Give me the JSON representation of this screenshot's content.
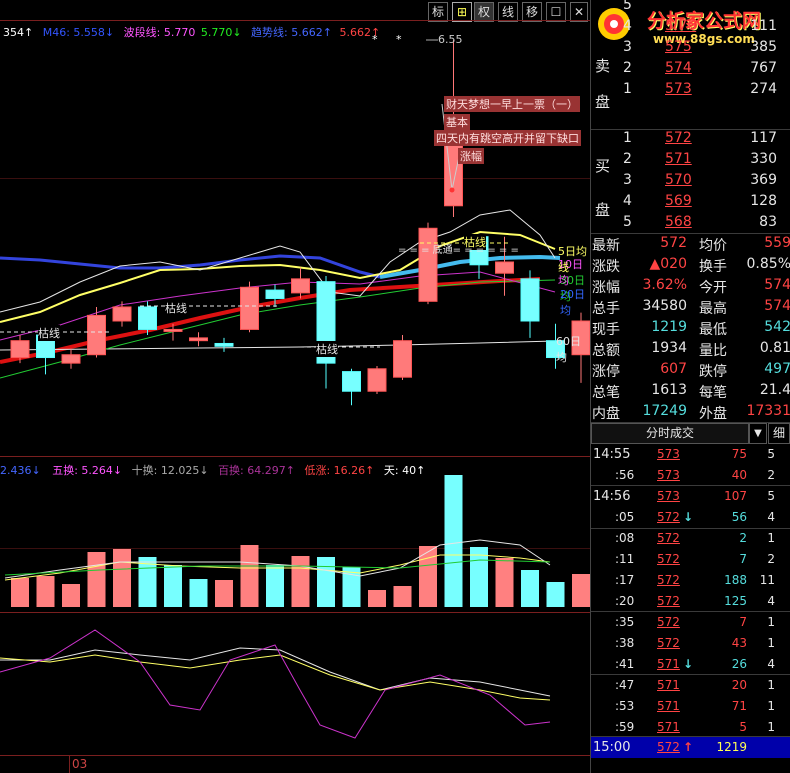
{
  "toolbar": {
    "buttons": [
      "标",
      "⊞",
      "权",
      "线",
      "移",
      "☐",
      "✕"
    ]
  },
  "ma_header": [
    {
      "text": "354↑",
      "color": "#ffffff"
    },
    {
      "text": "M46: 5.558↓",
      "color": "#3355ff"
    },
    {
      "text": "波段线: 5.770",
      "color": "#ff55ff"
    },
    {
      "text": "5.770↓",
      "color": "#22ee22"
    },
    {
      "text": "趋势线: 5.662↑",
      "color": "#4466ff"
    },
    {
      "text": "5.662↑",
      "color": "#ff4444"
    }
  ],
  "volume_header": [
    {
      "text": "2.436↓",
      "color": "#4466ff"
    },
    {
      "text": "五换: 5.264↓",
      "color": "#ff55ff"
    },
    {
      "text": "十换: 12.025↓",
      "color": "#aaaaaa"
    },
    {
      "text": "百换: 64.297↑",
      "color": "#aa3399"
    },
    {
      "text": "低涨: 16.26↑",
      "color": "#ff4444"
    },
    {
      "text": "天: 40↑",
      "color": "#ffffff"
    }
  ],
  "chart_labels": {
    "high_price": "6.55",
    "ann_1": "财天梦想一早上一票（一）",
    "ann_2": "基本",
    "ann_3": "四天内有跳空高开并留下缺口",
    "ann_4": "涨幅",
    "ku_1": "枯线",
    "ku_2": "枯线",
    "ku_3": "枯线",
    "ku_4": "枯线",
    "tongdao": "= = = 底通= = = = = =",
    "ma60": "60日均",
    "ma30": "30日均",
    "ma20": "20日均",
    "ma10": "10日均",
    "ma5": "5日均线",
    "date": "03"
  },
  "candles": [
    {
      "o": 5.42,
      "c": 5.48,
      "h": 5.5,
      "l": 5.4
    },
    {
      "o": 5.5,
      "c": 5.42,
      "h": 5.52,
      "l": 5.36
    },
    {
      "o": 5.4,
      "c": 5.43,
      "h": 5.45,
      "l": 5.38
    },
    {
      "o": 5.43,
      "c": 5.57,
      "h": 5.6,
      "l": 5.42
    },
    {
      "o": 5.55,
      "c": 5.6,
      "h": 5.62,
      "l": 5.53
    },
    {
      "o": 5.6,
      "c": 5.52,
      "h": 5.62,
      "l": 5.5
    },
    {
      "o": 5.52,
      "c": 5.52,
      "h": 5.54,
      "l": 5.48
    },
    {
      "o": 5.48,
      "c": 5.49,
      "h": 5.51,
      "l": 5.46
    },
    {
      "o": 5.47,
      "c": 5.46,
      "h": 5.49,
      "l": 5.44
    },
    {
      "o": 5.52,
      "c": 5.67,
      "h": 5.69,
      "l": 5.51
    },
    {
      "o": 5.66,
      "c": 5.63,
      "h": 5.68,
      "l": 5.6
    },
    {
      "o": 5.65,
      "c": 5.7,
      "h": 5.74,
      "l": 5.63
    },
    {
      "o": 5.69,
      "c": 5.4,
      "h": 5.71,
      "l": 5.31
    },
    {
      "o": 5.37,
      "c": 5.3,
      "h": 5.38,
      "l": 5.25
    },
    {
      "o": 5.3,
      "c": 5.38,
      "h": 5.39,
      "l": 5.29
    },
    {
      "o": 5.35,
      "c": 5.48,
      "h": 5.5,
      "l": 5.34
    },
    {
      "o": 5.62,
      "c": 5.88,
      "h": 5.9,
      "l": 5.61
    },
    {
      "o": 5.96,
      "c": 6.26,
      "h": 6.55,
      "l": 5.92
    },
    {
      "o": 5.85,
      "c": 5.75,
      "h": 5.86,
      "l": 5.7
    },
    {
      "o": 5.72,
      "c": 5.76,
      "h": 5.85,
      "l": 5.64
    },
    {
      "o": 5.7,
      "c": 5.55,
      "h": 5.73,
      "l": 5.49
    },
    {
      "o": 5.48,
      "c": 5.42,
      "h": 5.54,
      "l": 5.38
    },
    {
      "o": 5.43,
      "c": 5.55,
      "h": 5.58,
      "l": 5.33
    }
  ],
  "volumes": [
    {
      "v": 29,
      "up": true
    },
    {
      "v": 31,
      "up": true
    },
    {
      "v": 23,
      "up": true
    },
    {
      "v": 55,
      "up": true
    },
    {
      "v": 58,
      "up": true
    },
    {
      "v": 50,
      "up": false
    },
    {
      "v": 42,
      "up": false
    },
    {
      "v": 28,
      "up": false
    },
    {
      "v": 27,
      "up": true
    },
    {
      "v": 62,
      "up": true
    },
    {
      "v": 42,
      "up": false
    },
    {
      "v": 51,
      "up": true
    },
    {
      "v": 50,
      "up": false
    },
    {
      "v": 40,
      "up": false
    },
    {
      "v": 17,
      "up": true
    },
    {
      "v": 21,
      "up": true
    },
    {
      "v": 61,
      "up": true
    },
    {
      "v": 132,
      "up": false
    },
    {
      "v": 60,
      "up": false
    },
    {
      "v": 49,
      "up": true
    },
    {
      "v": 37,
      "up": false
    },
    {
      "v": 25,
      "up": false
    },
    {
      "v": 33,
      "up": true
    }
  ],
  "logo": {
    "title": "分析家公式网",
    "url": "www.88gs.com"
  },
  "sell_label": [
    "卖",
    "盘"
  ],
  "buy_label": [
    "买",
    "盘"
  ],
  "sell_orders": [
    {
      "level": "5",
      "price": "",
      "vol": ""
    },
    {
      "level": "4",
      "price": "5.76",
      "vol": "111"
    },
    {
      "level": "3",
      "price": "575",
      "vol": "385"
    },
    {
      "level": "2",
      "price": "574",
      "vol": "767"
    },
    {
      "level": "1",
      "price": "573",
      "vol": "274"
    }
  ],
  "buy_orders": [
    {
      "level": "1",
      "price": "572",
      "vol": "117"
    },
    {
      "level": "2",
      "price": "571",
      "vol": "330"
    },
    {
      "level": "3",
      "price": "570",
      "vol": "369"
    },
    {
      "level": "4",
      "price": "569",
      "vol": "128"
    },
    {
      "level": "5",
      "price": "568",
      "vol": "83"
    }
  ],
  "stats": [
    {
      "l1": "最新",
      "v1": "572",
      "c1": "#ff4444",
      "l2": "均价",
      "v2": "559",
      "c2": "#ff4444"
    },
    {
      "l1": "涨跌",
      "v1": "▲020",
      "c1": "#ff4444",
      "l2": "换手",
      "v2": "0.85%",
      "c2": "#e6e6e6"
    },
    {
      "l1": "涨幅",
      "v1": "3.62%",
      "c1": "#ff4444",
      "l2": "今开",
      "v2": "574",
      "c2": "#ff4444"
    },
    {
      "l1": "总手",
      "v1": "34580",
      "c1": "#e6e6e6",
      "l2": "最高",
      "v2": "574",
      "c2": "#ff4444"
    },
    {
      "l1": "现手",
      "v1": "1219",
      "c1": "#55dddd",
      "l2": "最低",
      "v2": "542",
      "c2": "#55dddd"
    },
    {
      "l1": "总额",
      "v1": "1934",
      "c1": "#e6e6e6",
      "l2": "量比",
      "v2": "0.81",
      "c2": "#e6e6e6"
    },
    {
      "l1": "涨停",
      "v1": "607",
      "c1": "#ff4444",
      "l2": "跌停",
      "v2": "497",
      "c2": "#55dddd"
    },
    {
      "l1": "总笔",
      "v1": "1613",
      "c1": "#e6e6e6",
      "l2": "每笔",
      "v2": "21.4",
      "c2": "#e6e6e6"
    },
    {
      "l1": "内盘",
      "v1": "17249",
      "c1": "#55dddd",
      "l2": "外盘",
      "v2": "17331",
      "c2": "#ff4444"
    }
  ],
  "trades_tab": {
    "label": "分时成交",
    "arrow": "▼",
    "detail": "细"
  },
  "trades": [
    {
      "time": "14:55",
      "price": "573",
      "arrow": "",
      "vol": "75",
      "vc": "#ff4444",
      "n": "5",
      "big": true
    },
    {
      "time": ":56",
      "price": "573",
      "arrow": "",
      "vol": "40",
      "vc": "#ff4444",
      "n": "2",
      "big": false
    },
    {
      "time": "14:56",
      "price": "573",
      "arrow": "",
      "vol": "107",
      "vc": "#ff4444",
      "n": "5",
      "big": true
    },
    {
      "time": ":05",
      "price": "572",
      "arrow": "↓",
      "vol": "56",
      "vc": "#55dddd",
      "n": "4",
      "big": false
    },
    {
      "time": ":08",
      "price": "572",
      "arrow": "",
      "vol": "2",
      "vc": "#55dddd",
      "n": "1",
      "big": false
    },
    {
      "time": ":11",
      "price": "572",
      "arrow": "",
      "vol": "7",
      "vc": "#55dddd",
      "n": "2",
      "big": false
    },
    {
      "time": ":17",
      "price": "572",
      "arrow": "",
      "vol": "188",
      "vc": "#55dddd",
      "n": "11",
      "big": false
    },
    {
      "time": ":20",
      "price": "572",
      "arrow": "",
      "vol": "125",
      "vc": "#55dddd",
      "n": "4",
      "big": false
    },
    {
      "time": ":35",
      "price": "572",
      "arrow": "",
      "vol": "7",
      "vc": "#ff4444",
      "n": "1",
      "big": false
    },
    {
      "time": ":38",
      "price": "572",
      "arrow": "",
      "vol": "43",
      "vc": "#ff4444",
      "n": "1",
      "big": false
    },
    {
      "time": ":41",
      "price": "571",
      "arrow": "↓",
      "vol": "26",
      "vc": "#55dddd",
      "n": "4",
      "big": false
    },
    {
      "time": ":47",
      "price": "571",
      "arrow": "",
      "vol": "20",
      "vc": "#ff4444",
      "n": "1",
      "big": false
    },
    {
      "time": ":53",
      "price": "571",
      "arrow": "",
      "vol": "71",
      "vc": "#ff4444",
      "n": "1",
      "big": false
    },
    {
      "time": ":59",
      "price": "571",
      "arrow": "",
      "vol": "5",
      "vc": "#ff4444",
      "n": "1",
      "big": false
    },
    {
      "time": "15:00",
      "price": "572",
      "arrow": "↑",
      "vol": "1219",
      "vc": "#ffff55",
      "n": "",
      "big": true
    }
  ]
}
